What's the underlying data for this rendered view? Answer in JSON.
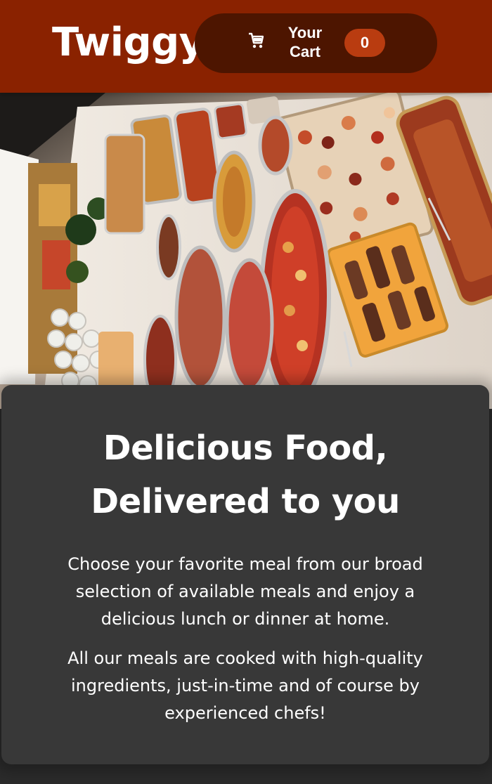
{
  "header": {
    "brand": "Twiggy",
    "cart": {
      "icon": "shopping-cart-icon",
      "label": "Your Cart",
      "count": "0"
    }
  },
  "hero": {
    "image": "buffet-table-photo"
  },
  "summary": {
    "title": "Delicious Food, Delivered to you",
    "paragraph1": "Choose your favorite meal from our broad selection of available meals and enjoy a delicious lunch or dinner at home.",
    "paragraph2": "All our meals are cooked with high-quality ingredients, just-in-time and of course by experienced chefs!"
  },
  "colors": {
    "header_bg": "#8a2200",
    "cart_button_bg": "#4d1500",
    "badge_bg": "#b93c10",
    "card_bg": "#383838",
    "page_bg": "#2b2b2b"
  }
}
